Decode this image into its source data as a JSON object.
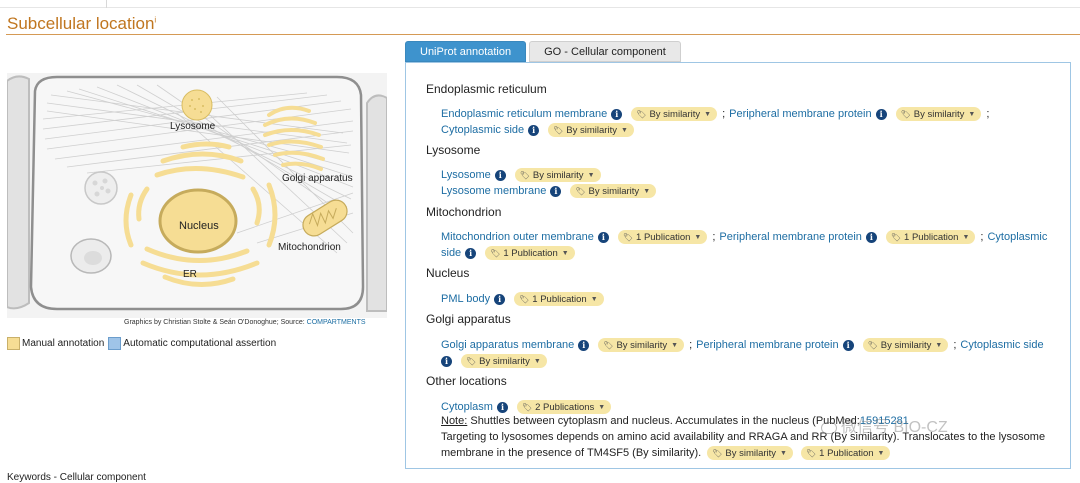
{
  "section": {
    "title": "Subcellular location",
    "title_marker": "i"
  },
  "illustration": {
    "labels": {
      "lysosome": "Lysosome",
      "golgi": "Golgi apparatus",
      "nucleus": "Nucleus",
      "mitochondrion": "Mitochondrion",
      "er": "ER"
    },
    "credit_text": "Graphics by Christian Stolte & Seán O'Donoghue; Source: ",
    "credit_link": "COMPARTMENTS",
    "legend": {
      "manual": "Manual annotation",
      "automatic": "Automatic computational assertion"
    },
    "colors": {
      "manual": "#f6dd94",
      "automatic": "#9fc4e8"
    }
  },
  "tabs": [
    {
      "label": "UniProt annotation",
      "active": true
    },
    {
      "label": "GO - Cellular component",
      "active": false
    }
  ],
  "annotation": {
    "pill_labels": {
      "similarity": "By similarity",
      "one_pub": "1 Publication",
      "two_pub": "2 Publications"
    },
    "sections": {
      "er": "Endoplasmic reticulum",
      "lysosome": "Lysosome",
      "mitochondrion": "Mitochondrion",
      "nucleus": "Nucleus",
      "golgi": "Golgi apparatus",
      "other": "Other locations"
    },
    "locations": {
      "er_membrane": "Endoplasmic reticulum membrane",
      "peripheral_membrane_protein": "Peripheral membrane protein",
      "cytoplasmic_side": "Cytoplasmic side",
      "cytoplasmic_prefix": "Cytoplasmic",
      "side_suffix": "side",
      "lysosome": "Lysosome",
      "lysosome_membrane": "Lysosome membrane",
      "mito_outer_membrane": "Mitochondrion outer membrane",
      "pml_body": "PML body",
      "golgi_membrane": "Golgi apparatus membrane",
      "cytoplasm": "Cytoplasm"
    },
    "separator": ";",
    "note": {
      "label": "Note:",
      "line1": " Shuttles between cytoplasm and nucleus. Accumulates in the nucleus (",
      "line1_tail": "PubMed:",
      "pmid": "15915281",
      "line2": "Targeting to lysosomes depends on amino acid availability and RRAGA and RR",
      "line2_tail": " (By similarity). Translocates to the lysosome",
      "line3": "membrane in the presence of TM4SF5 (By similarity)."
    }
  },
  "watermark": "微信号 BIO-CZ",
  "bottom_text": "Keywords - Cellular component"
}
